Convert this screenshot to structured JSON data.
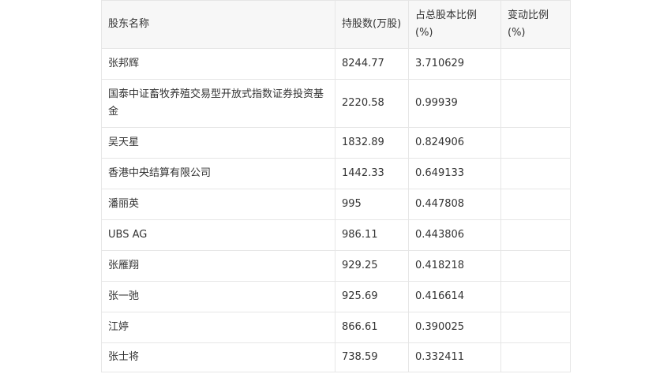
{
  "table": {
    "headers": [
      "股东名称",
      "持股数(万股)",
      "占总股本比例(%)",
      "变动比例(%)"
    ],
    "rows": [
      [
        "张邦辉",
        "8244.77",
        "3.710629",
        ""
      ],
      [
        "国泰中证畜牧养殖交易型开放式指数证券投资基金",
        "2220.58",
        "0.99939",
        ""
      ],
      [
        "吴天星",
        "1832.89",
        "0.824906",
        ""
      ],
      [
        "香港中央结算有限公司",
        "1442.33",
        "0.649133",
        ""
      ],
      [
        "潘丽英",
        "995",
        "0.447808",
        ""
      ],
      [
        "UBS AG",
        "986.11",
        "0.443806",
        ""
      ],
      [
        "张雁翔",
        "929.25",
        "0.418218",
        ""
      ],
      [
        "张一弛",
        "925.69",
        "0.416614",
        ""
      ],
      [
        "江婷",
        "866.61",
        "0.390025",
        ""
      ],
      [
        "张士将",
        "738.59",
        "0.332411",
        ""
      ]
    ]
  }
}
